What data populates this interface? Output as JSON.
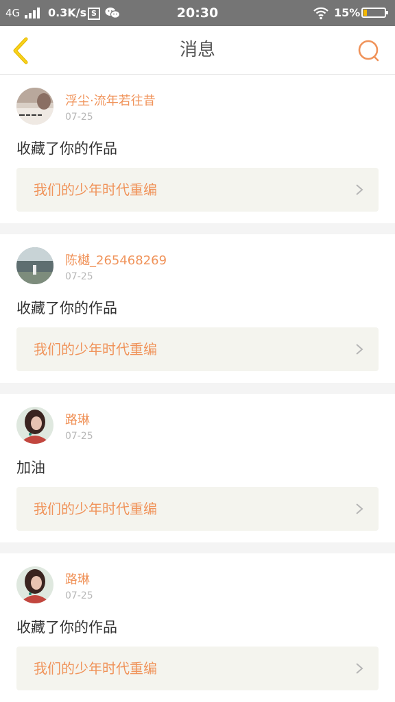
{
  "status_bar": {
    "network": "4G",
    "speed": "0.3K/s",
    "s_icon_label": "S",
    "time": "20:30",
    "battery_percent": "15%",
    "battery_level": 0.15
  },
  "header": {
    "title": "消息",
    "back_icon": "back-chevron-icon",
    "search_icon": "search-icon",
    "accent_color": "#f0935a",
    "back_color": "#f5c400"
  },
  "messages": [
    {
      "username": "浮尘·流年若往昔",
      "date": "07-25",
      "text": "收藏了你的作品",
      "work_title": "我们的少年时代重编"
    },
    {
      "username": "陈樾_265468269",
      "date": "07-25",
      "text": "收藏了你的作品",
      "work_title": "我们的少年时代重编"
    },
    {
      "username": "路琳",
      "date": "07-25",
      "text": "加油",
      "work_title": "我们的少年时代重编"
    },
    {
      "username": "路琳",
      "date": "07-25",
      "text": "收藏了你的作品",
      "work_title": "我们的少年时代重编"
    }
  ]
}
